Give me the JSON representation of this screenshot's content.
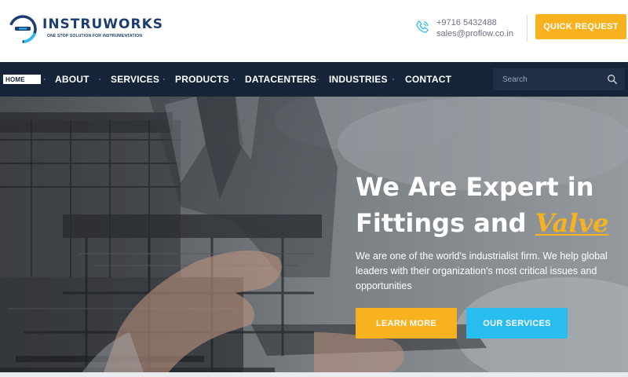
{
  "brand": {
    "name": "INSTRUWORKS",
    "tagline": "ONE STOP SOLUTION FOR INSTRUMENTATION",
    "primary_color": "#1c3d73",
    "icon": "instruworks-logo-icon"
  },
  "contact": {
    "phone": "+9716 5432488",
    "email": "sales@proflow.co.in",
    "icon": "phone-icon"
  },
  "header": {
    "quick_request_label": "QUICK REQUEST"
  },
  "nav": {
    "items": [
      {
        "label": "HOME",
        "active": true
      },
      {
        "label": "ABOUT"
      },
      {
        "label": "SERVICES"
      },
      {
        "label": "PRODUCTS"
      },
      {
        "label": "DATACENTERS"
      },
      {
        "label": "INDUSTRIES"
      },
      {
        "label": "CONTACT"
      }
    ],
    "background": "#16243a"
  },
  "search": {
    "placeholder": "Search",
    "value": "",
    "icon": "search-icon"
  },
  "hero": {
    "title_line1": "We Are Expert in",
    "title_line2_prefix": "Fittings and",
    "title_accent": "Valve",
    "description": "We are one of the world's industrialist firm. We help global leaders with their organization's most critical issues and opportunities",
    "learn_more_label": "LEARN MORE",
    "our_services_label": "OUR SERVICES"
  },
  "colors": {
    "accent_yellow": "#f8b21f",
    "accent_cyan": "#27bdee"
  }
}
